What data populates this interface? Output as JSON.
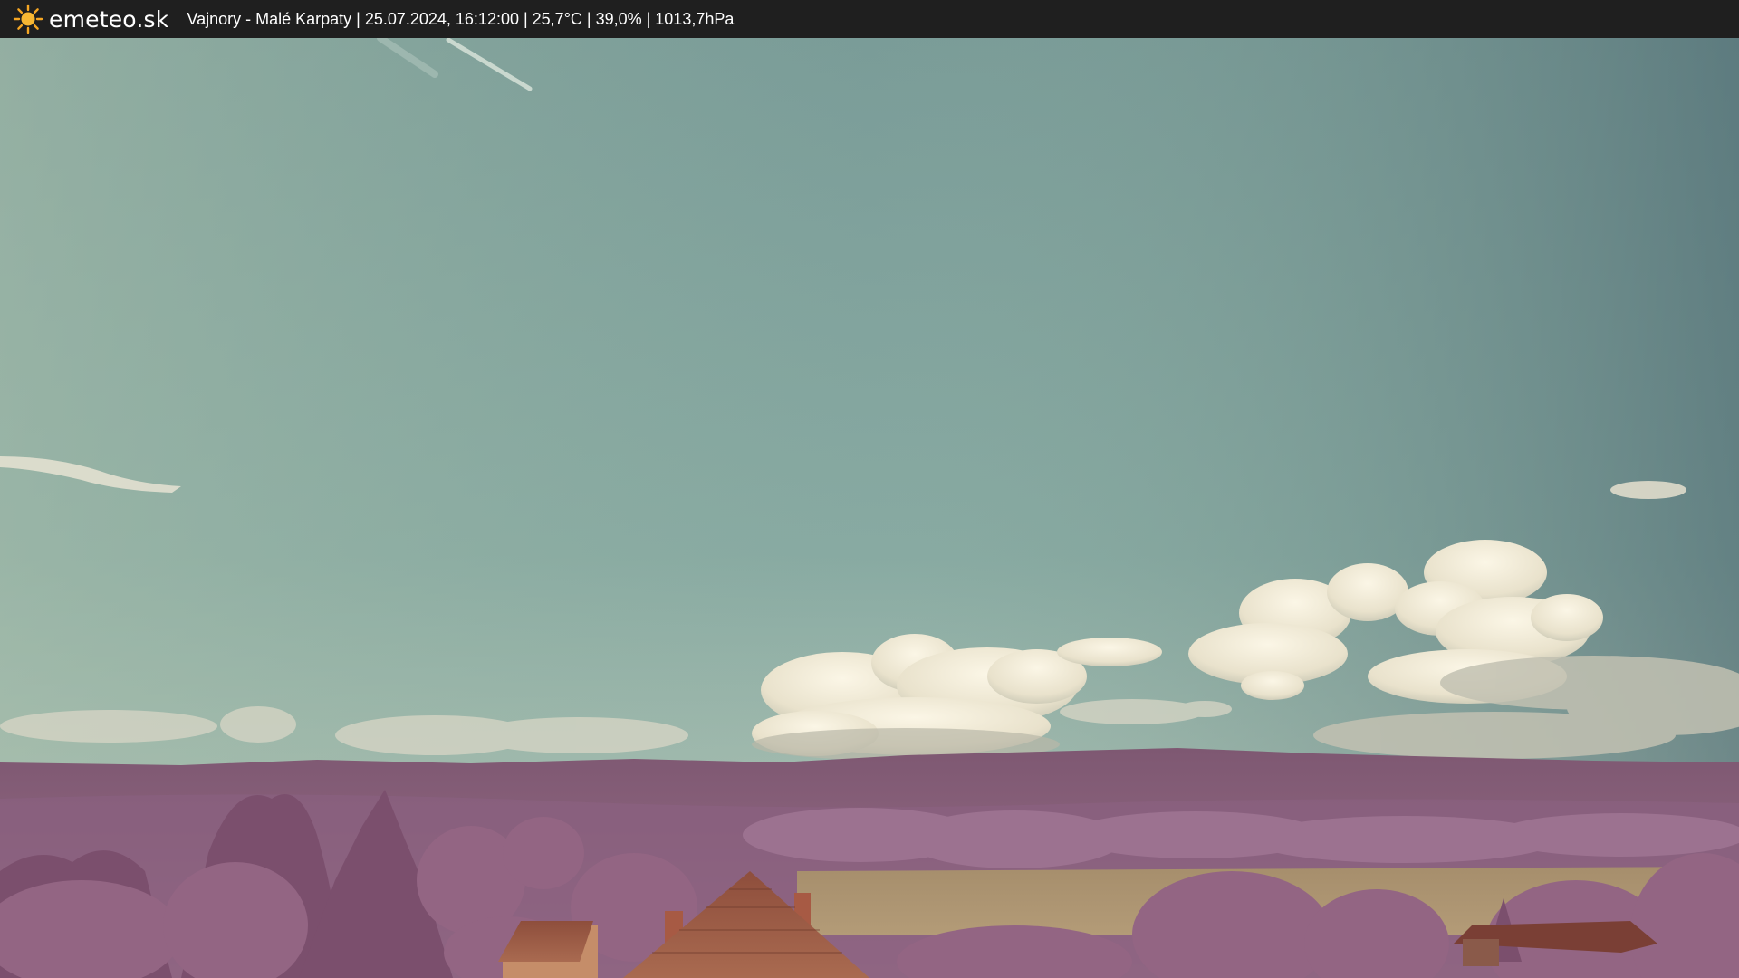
{
  "header": {
    "logo_text": "emeteo.sk",
    "logo_icon": "sun-icon",
    "info_line": "Vajnory - Malé Karpaty | 25.07.2024, 16:12:00 | 25,7°C | 39,0% | 1013,7hPa"
  },
  "colors": {
    "bar_background": "#1f1f1f",
    "sun": "#f5a623",
    "sky_top": "#6f8f8f",
    "sky_bottom": "#b6c4b0",
    "foliage": "#9a6a86",
    "roof": "#9a5a44"
  }
}
